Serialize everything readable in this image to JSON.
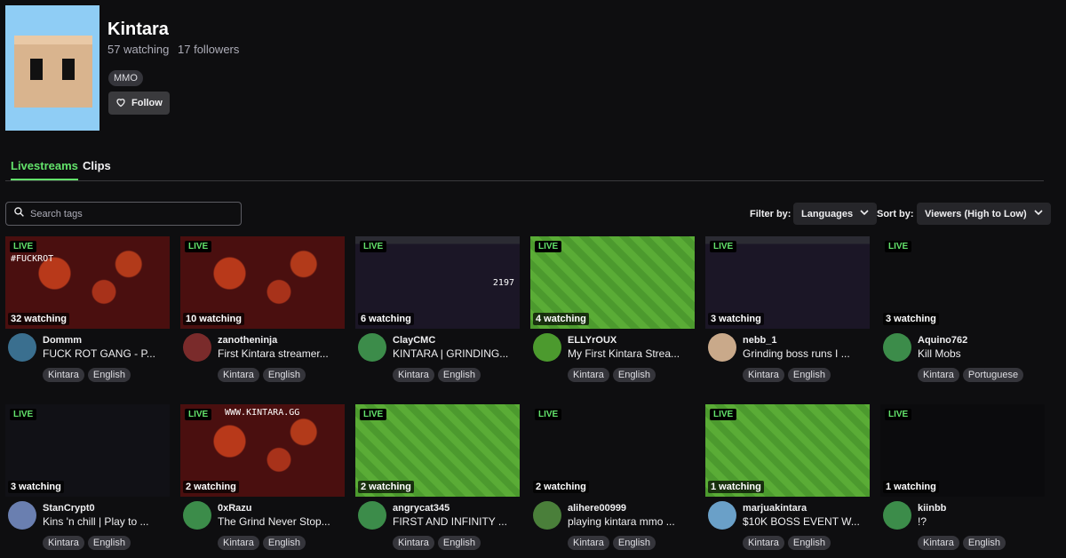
{
  "game": {
    "title": "Kintara",
    "watching": "57 watching",
    "followers": "17 followers",
    "genre": "MMO",
    "follow_label": "Follow"
  },
  "tabs": [
    {
      "label": "Livestreams",
      "active": true
    },
    {
      "label": "Clips",
      "active": false
    }
  ],
  "search": {
    "placeholder": "Search tags"
  },
  "filter": {
    "label": "Filter by:",
    "value": "Languages"
  },
  "sort": {
    "label": "Sort by:",
    "value": "Viewers (High to Low)"
  },
  "accent_color": "#63e26b",
  "streams": [
    {
      "streamer": "Dommm",
      "title": "FUCK ROT GANG - P...",
      "watching": "32 watching",
      "live": "LIVE",
      "tags": [
        "Kintara",
        "English"
      ],
      "thumb": "lava",
      "overlay_text": "#FUCKROT"
    },
    {
      "streamer": "zanotheninja",
      "title": "First Kintara streamer...",
      "watching": "10 watching",
      "live": "LIVE",
      "tags": [
        "Kintara",
        "English"
      ],
      "thumb": "lava"
    },
    {
      "streamer": "ClayCMC",
      "title": "KINTARA | GRINDING...",
      "watching": "6 watching",
      "live": "LIVE",
      "tags": [
        "Kintara",
        "English"
      ],
      "thumb": "dungeon",
      "overlay_text": "2197"
    },
    {
      "streamer": "ELLYrOUX",
      "title": "My First Kintara Strea...",
      "watching": "4 watching",
      "live": "LIVE",
      "tags": [
        "Kintara",
        "English"
      ],
      "thumb": "grass"
    },
    {
      "streamer": "nebb_1",
      "title": "Grinding boss runs I ...",
      "watching": "3 watching",
      "live": "LIVE",
      "tags": [
        "Kintara",
        "English"
      ],
      "thumb": "dungeon"
    },
    {
      "streamer": "Aquino762",
      "title": "Kill Mobs",
      "watching": "3 watching",
      "live": "LIVE",
      "tags": [
        "Kintara",
        "Portuguese"
      ],
      "thumb": "grass-water"
    },
    {
      "streamer": "StanCrypt0",
      "title": "Kins 'n chill | Play to ...",
      "watching": "3 watching",
      "live": "LIVE",
      "tags": [
        "Kintara",
        "English"
      ],
      "thumb": "desktop"
    },
    {
      "streamer": "0xRazu",
      "title": "The Grind Never Stop...",
      "watching": "2 watching",
      "live": "LIVE",
      "tags": [
        "Kintara",
        "English"
      ],
      "thumb": "lava",
      "overlay_text": "WWW.KINTARA.GG"
    },
    {
      "streamer": "angrycat345",
      "title": "FIRST AND INFINITY ...",
      "watching": "2 watching",
      "live": "LIVE",
      "tags": [
        "Kintara",
        "English"
      ],
      "thumb": "grass"
    },
    {
      "streamer": "alihere00999",
      "title": "playing kintara mmo ...",
      "watching": "2 watching",
      "live": "LIVE",
      "tags": [
        "Kintara",
        "English"
      ],
      "thumb": "grass-water"
    },
    {
      "streamer": "marjuakintara",
      "title": "$10K BOSS EVENT W...",
      "watching": "1 watching",
      "live": "LIVE",
      "tags": [
        "Kintara",
        "English"
      ],
      "thumb": "grass"
    },
    {
      "streamer": "kiinbb",
      "title": "!?",
      "watching": "1 watching",
      "live": "LIVE",
      "tags": [
        "Kintara",
        "English"
      ],
      "thumb": "dark"
    }
  ]
}
